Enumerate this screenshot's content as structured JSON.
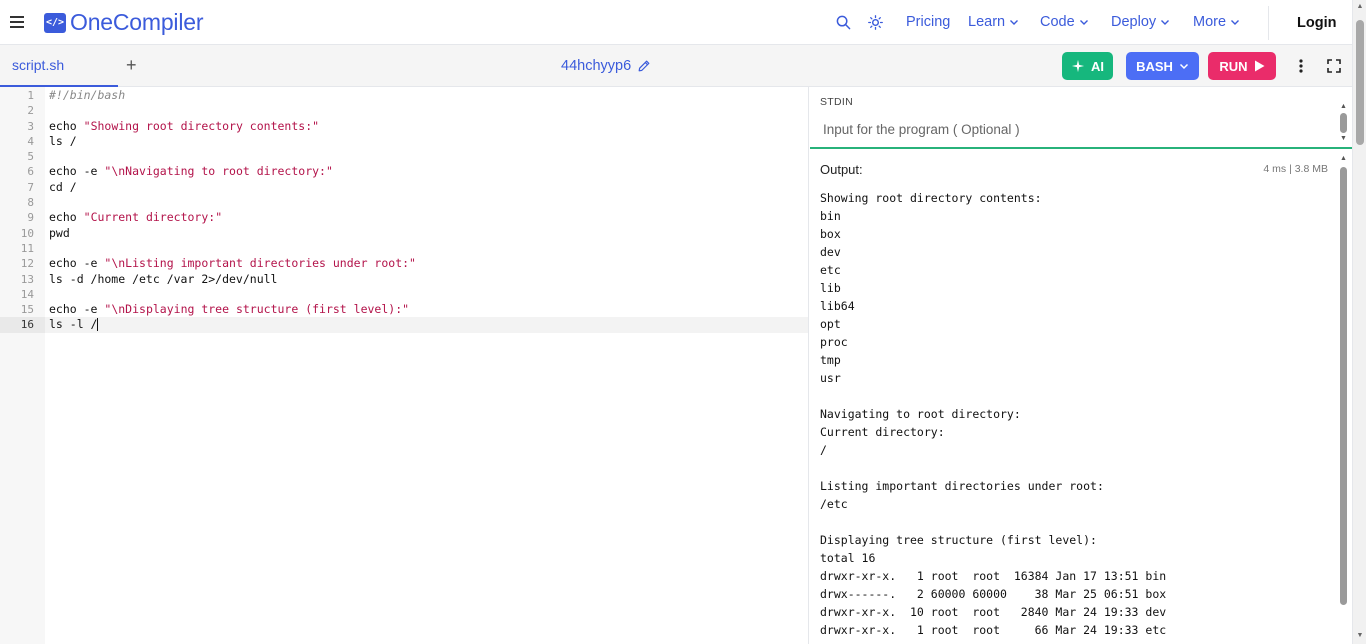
{
  "nav": {
    "brand": "OneCompiler",
    "logo_glyph": "</>",
    "links": [
      {
        "label": "Pricing",
        "has_dropdown": false
      },
      {
        "label": "Learn",
        "has_dropdown": true
      },
      {
        "label": "Code",
        "has_dropdown": true
      },
      {
        "label": "Deploy",
        "has_dropdown": true
      },
      {
        "label": "More",
        "has_dropdown": true
      }
    ],
    "login": "Login",
    "icons": [
      "menu-icon",
      "search-icon",
      "theme-sun-icon"
    ]
  },
  "editor_bar": {
    "file_tab": "script.sh",
    "add_tab": "+",
    "project_name": "44hchyyp6",
    "ai_label": "AI",
    "language_label": "BASH",
    "run_label": "RUN"
  },
  "code": {
    "active_line": 16,
    "lines": [
      {
        "n": "1",
        "tokens": [
          {
            "t": "comment",
            "v": "#!/bin/bash"
          }
        ]
      },
      {
        "n": "2",
        "tokens": []
      },
      {
        "n": "3",
        "tokens": [
          {
            "t": "kw",
            "v": "echo"
          },
          {
            "t": "plain",
            "v": " "
          },
          {
            "t": "str",
            "v": "\"Showing root directory contents:\""
          }
        ]
      },
      {
        "n": "4",
        "tokens": [
          {
            "t": "plain",
            "v": "ls /"
          }
        ]
      },
      {
        "n": "5",
        "tokens": []
      },
      {
        "n": "6",
        "tokens": [
          {
            "t": "kw",
            "v": "echo"
          },
          {
            "t": "plain",
            "v": " -e "
          },
          {
            "t": "str",
            "v": "\"\\nNavigating to root directory:\""
          }
        ]
      },
      {
        "n": "7",
        "tokens": [
          {
            "t": "plain",
            "v": "cd /"
          }
        ]
      },
      {
        "n": "8",
        "tokens": []
      },
      {
        "n": "9",
        "tokens": [
          {
            "t": "kw",
            "v": "echo"
          },
          {
            "t": "plain",
            "v": " "
          },
          {
            "t": "str",
            "v": "\"Current directory:\""
          }
        ]
      },
      {
        "n": "10",
        "tokens": [
          {
            "t": "plain",
            "v": "pwd"
          }
        ]
      },
      {
        "n": "11",
        "tokens": []
      },
      {
        "n": "12",
        "tokens": [
          {
            "t": "kw",
            "v": "echo"
          },
          {
            "t": "plain",
            "v": " -e "
          },
          {
            "t": "str",
            "v": "\"\\nListing important directories under root:\""
          }
        ]
      },
      {
        "n": "13",
        "tokens": [
          {
            "t": "plain",
            "v": "ls -d /home /etc /var 2>/dev/null"
          }
        ]
      },
      {
        "n": "14",
        "tokens": []
      },
      {
        "n": "15",
        "tokens": [
          {
            "t": "kw",
            "v": "echo"
          },
          {
            "t": "plain",
            "v": " -e "
          },
          {
            "t": "str",
            "v": "\"\\nDisplaying tree structure (first level):\""
          }
        ]
      },
      {
        "n": "16",
        "tokens": [
          {
            "t": "plain",
            "v": "ls -l /"
          }
        ]
      }
    ]
  },
  "stdin": {
    "label": "STDIN",
    "placeholder": "Input for the program ( Optional )"
  },
  "output": {
    "label": "Output:",
    "stats": "4 ms | 3.8 MB",
    "lines": [
      "Showing root directory contents:",
      "bin",
      "box",
      "dev",
      "etc",
      "lib",
      "lib64",
      "opt",
      "proc",
      "tmp",
      "usr",
      "",
      "Navigating to root directory:",
      "Current directory:",
      "/",
      "",
      "Listing important directories under root:",
      "/etc",
      "",
      "Displaying tree structure (first level):",
      "total 16",
      "drwxr-xr-x.   1 root  root  16384 Jan 17 13:51 bin",
      "drwx------.   2 60000 60000    38 Mar 25 06:51 box",
      "drwxr-xr-x.  10 root  root   2840 Mar 24 19:33 dev",
      "drwxr-xr-x.   1 root  root     66 Mar 24 19:33 etc"
    ]
  },
  "colors": {
    "brand": "#3b5bdb",
    "ai": "#16b77d",
    "bash": "#4c6ef5",
    "run": "#ea2c6a",
    "string": "#b3134a",
    "stdin_separator": "#27b27a"
  }
}
